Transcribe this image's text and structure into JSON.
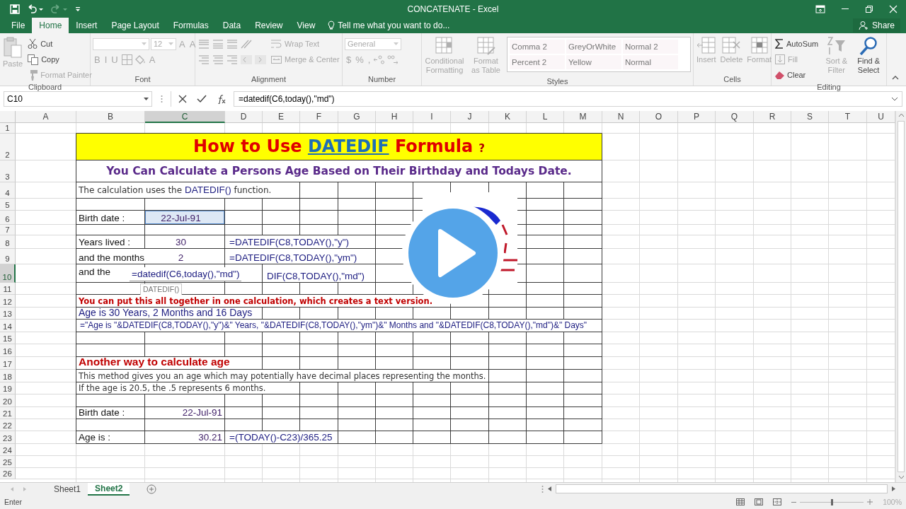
{
  "window": {
    "title": "CONCATENATE - Excel"
  },
  "menu_tabs": [
    {
      "label": "File",
      "selected": false
    },
    {
      "label": "Home",
      "selected": true
    },
    {
      "label": "Insert",
      "selected": false
    },
    {
      "label": "Page Layout",
      "selected": false
    },
    {
      "label": "Formulas",
      "selected": false
    },
    {
      "label": "Data",
      "selected": false
    },
    {
      "label": "Review",
      "selected": false
    },
    {
      "label": "View",
      "selected": false
    }
  ],
  "tell_me": {
    "placeholder": "Tell me what you want to do..."
  },
  "share": "Share",
  "ribbon": [
    {
      "name": "Clipboard",
      "blocks": [
        {
          "kind": "large",
          "label": "Paste",
          "disabled": true
        },
        {
          "kind": "stack",
          "lines": [
            {
              "items": [
                {
                  "kind": "small",
                  "label": "Cut",
                  "disabled": false
                }
              ]
            },
            {
              "items": [
                {
                  "kind": "small",
                  "label": "Copy",
                  "disabled": false
                }
              ]
            },
            {
              "items": [
                {
                  "kind": "small",
                  "label": "Format Painter",
                  "disabled": true
                }
              ]
            }
          ]
        }
      ]
    },
    {
      "name": "Font",
      "blocks": [
        {
          "kind": "stack",
          "lines": [
            {
              "items": [
                {
                  "kind": "field",
                  "wide": true
                },
                {
                  "kind": "field",
                  "value": "12",
                  "wide": false
                },
                {
                  "kind": "glyph",
                  "label": "A"
                },
                {
                  "kind": "glyph",
                  "label": "A"
                }
              ]
            },
            {
              "items": [
                {
                  "kind": "glyph",
                  "label": "B"
                },
                {
                  "kind": "glyph",
                  "label": "I"
                },
                {
                  "kind": "glyph",
                  "label": "U"
                },
                {
                  "kind": "icon"
                },
                {
                  "kind": "icon"
                },
                {
                  "kind": "glyph",
                  "label": "A"
                }
              ]
            }
          ]
        }
      ]
    },
    {
      "name": "Alignment",
      "blocks": [
        {
          "kind": "stack",
          "lines": [
            {
              "items": [
                {
                  "kind": "icon"
                },
                {
                  "kind": "icon"
                },
                {
                  "kind": "icon"
                },
                {
                  "kind": "icon"
                }
              ]
            },
            {
              "items": [
                {
                  "kind": "icon"
                },
                {
                  "kind": "icon"
                },
                {
                  "kind": "icon"
                },
                {
                  "kind": "icon"
                },
                {
                  "kind": "icon"
                }
              ]
            }
          ]
        },
        {
          "kind": "stack",
          "lines": [
            {
              "items": [
                {
                  "kind": "small",
                  "label": "Wrap Text",
                  "disabled": true
                }
              ]
            },
            {
              "items": [
                {
                  "kind": "small",
                  "label": "Merge & Center",
                  "disabled": true
                }
              ]
            }
          ]
        }
      ]
    },
    {
      "name": "Number",
      "blocks": [
        {
          "kind": "stack",
          "lines": [
            {
              "items": [
                {
                  "kind": "field",
                  "value": "General",
                  "wide": true
                }
              ]
            },
            {
              "items": [
                {
                  "kind": "glyph",
                  "label": "$"
                },
                {
                  "kind": "glyph",
                  "label": "%"
                },
                {
                  "kind": "glyph",
                  "label": ","
                },
                {
                  "kind": "icon"
                },
                {
                  "kind": "icon"
                }
              ]
            }
          ]
        }
      ]
    },
    {
      "name": "Styles",
      "blocks": [
        {
          "kind": "large",
          "label": "Conditional Formatting",
          "disabled": true
        },
        {
          "kind": "large",
          "label": "Format as Table",
          "disabled": true
        },
        {
          "kind": "gallery",
          "styles": [
            "Comma 2",
            "GreyOrWhite",
            "Normal 2",
            "Percent 2",
            "Yellow",
            "Normal"
          ]
        }
      ]
    },
    {
      "name": "Cells",
      "blocks": [
        {
          "kind": "large",
          "label": "Insert",
          "disabled": true
        },
        {
          "kind": "large",
          "label": "Delete",
          "disabled": true
        },
        {
          "kind": "large",
          "label": "Format",
          "disabled": true
        }
      ]
    },
    {
      "name": "Editing",
      "blocks": [
        {
          "kind": "stack",
          "lines": [
            {
              "items": [
                {
                  "kind": "small",
                  "label": "AutoSum",
                  "disabled": false
                }
              ]
            },
            {
              "items": [
                {
                  "kind": "small",
                  "label": "Fill",
                  "disabled": true
                }
              ]
            },
            {
              "items": [
                {
                  "kind": "small",
                  "label": "Clear",
                  "disabled": false
                }
              ]
            }
          ]
        },
        {
          "kind": "large",
          "label": "Sort & Filter",
          "disabled": true
        },
        {
          "kind": "large",
          "label": "Find & Select",
          "disabled": false
        }
      ]
    }
  ],
  "formula_bar": {
    "name_box": "C10",
    "formula": "=datedif(C6,today(),\"md\")"
  },
  "columns": [
    {
      "label": "A",
      "selected": false
    },
    {
      "label": "B",
      "selected": false
    },
    {
      "label": "C",
      "selected": true
    },
    {
      "label": "D",
      "selected": false
    },
    {
      "label": "E",
      "selected": false
    },
    {
      "label": "F",
      "selected": false
    },
    {
      "label": "G",
      "selected": false
    },
    {
      "label": "H",
      "selected": false
    },
    {
      "label": "I",
      "selected": false
    },
    {
      "label": "J",
      "selected": false
    },
    {
      "label": "K",
      "selected": false
    },
    {
      "label": "L",
      "selected": false
    },
    {
      "label": "M",
      "selected": false
    },
    {
      "label": "N",
      "selected": false
    },
    {
      "label": "O",
      "selected": false
    },
    {
      "label": "P",
      "selected": false
    },
    {
      "label": "Q",
      "selected": false
    },
    {
      "label": "R",
      "selected": false
    },
    {
      "label": "S",
      "selected": false
    },
    {
      "label": "T",
      "selected": false
    },
    {
      "label": "U",
      "selected": false
    }
  ],
  "rows": [
    {
      "number": "1",
      "selected": false
    },
    {
      "number": "2",
      "selected": false,
      "cells": [
        null,
        {
          "kind": "title",
          "lead": "How to Use ",
          "keyword": "DATEDIF",
          "tail": " Formula",
          "mark": "?",
          "referenced": false
        }
      ]
    },
    {
      "number": "3",
      "selected": false,
      "cells": [
        null,
        {
          "kind": "subtitle",
          "text": "You Can Calculate a Persons Age Based on Their Birthday and Todays Date.",
          "referenced": false
        }
      ]
    },
    {
      "number": "4",
      "selected": false,
      "cells": [
        null,
        {
          "kind": "intro",
          "lead": "The calculation uses the ",
          "keyword": "DATEDIF()",
          "tail": " function.",
          "referenced": false
        }
      ]
    },
    {
      "number": "5",
      "selected": false
    },
    {
      "number": "6",
      "selected": false,
      "cells": [
        null,
        {
          "kind": "label",
          "text": "Birth date :",
          "referenced": false
        },
        {
          "kind": "value",
          "text": "22-Jul-91",
          "referenced": true
        }
      ]
    },
    {
      "number": "7",
      "selected": false
    },
    {
      "number": "8",
      "selected": false,
      "cells": [
        null,
        {
          "kind": "label",
          "text": "Years lived :",
          "referenced": false
        },
        {
          "kind": "value",
          "text": "30",
          "referenced": false
        },
        {
          "kind": "formula",
          "text": "=DATEDIF(C8,TODAY(),\"y\")",
          "referenced": false
        }
      ]
    },
    {
      "number": "9",
      "selected": false,
      "cells": [
        null,
        {
          "kind": "label",
          "text": "and the months",
          "referenced": false
        },
        {
          "kind": "value",
          "text": "2",
          "referenced": false
        },
        {
          "kind": "formula",
          "text": "=DATEDIF(C8,TODAY(),\"ym\")",
          "referenced": false
        }
      ]
    },
    {
      "number": "10",
      "selected": true,
      "cells": [
        null,
        {
          "kind": "label-top",
          "text": "and the",
          "referenced": false
        },
        {
          "kind": "editor",
          "text": "=datedif(C6,today(),\"md\")",
          "hint": "DATEDIF()",
          "referenced": false
        },
        null,
        {
          "kind": "formula",
          "text": "DIF(C8,TODAY(),\"md\")",
          "referenced": false
        }
      ]
    },
    {
      "number": "11",
      "selected": false
    },
    {
      "number": "12",
      "selected": false,
      "cells": [
        null,
        {
          "kind": "note",
          "text": "You can put this all together in one calculation, which creates a text version.",
          "referenced": false
        }
      ]
    },
    {
      "number": "13",
      "selected": false,
      "cells": [
        null,
        {
          "kind": "result",
          "text": "Age is 30 Years, 2 Months and 16 Days",
          "referenced": false
        }
      ]
    },
    {
      "number": "14",
      "selected": false,
      "cells": [
        null,
        {
          "kind": "long-formula",
          "text": "=\"Age is \"&DATEDIF(C8,TODAY(),\"y\")&\" Years, \"&DATEDIF(C8,TODAY(),\"ym\")&\" Months and \"&DATEDIF(C8,TODAY(),\"md\")&\" Days\"",
          "referenced": false
        }
      ]
    },
    {
      "number": "15",
      "selected": false
    },
    {
      "number": "16",
      "selected": false
    },
    {
      "number": "17",
      "selected": false,
      "cells": [
        null,
        {
          "kind": "heading",
          "text": "Another way to calculate age",
          "referenced": false
        }
      ]
    },
    {
      "number": "18",
      "selected": false,
      "cells": [
        null,
        {
          "kind": "text",
          "text": "This method gives you an age which may potentially have decimal places representing the months.",
          "referenced": false
        }
      ]
    },
    {
      "number": "19",
      "selected": false,
      "cells": [
        null,
        {
          "kind": "text",
          "text": "If the age is 20.5, the .5 represents 6 months.",
          "referenced": false
        }
      ]
    },
    {
      "number": "20",
      "selected": false
    },
    {
      "number": "21",
      "selected": false,
      "cells": [
        null,
        {
          "kind": "label",
          "text": "Birth date :",
          "referenced": false
        },
        {
          "kind": "value-right",
          "text": "22-Jul-91",
          "referenced": false
        }
      ]
    },
    {
      "number": "22",
      "selected": false
    },
    {
      "number": "23",
      "selected": false,
      "cells": [
        null,
        {
          "kind": "label",
          "text": "Age is :",
          "referenced": false
        },
        {
          "kind": "value-right",
          "text": "30.21",
          "referenced": false
        },
        {
          "kind": "formula",
          "text": "=(TODAY()-C23)/365.25",
          "referenced": false
        }
      ]
    },
    {
      "number": "24",
      "selected": false
    },
    {
      "number": "25",
      "selected": false
    },
    {
      "number": "26",
      "selected": false
    }
  ],
  "sheet_tabs": [
    {
      "label": "Sheet1",
      "selected": false
    },
    {
      "label": "Sheet2",
      "selected": true
    }
  ],
  "status_bar": {
    "mode": "Enter",
    "zoom_slider": {
      "level": 0.5
    },
    "zoom": "100%"
  }
}
